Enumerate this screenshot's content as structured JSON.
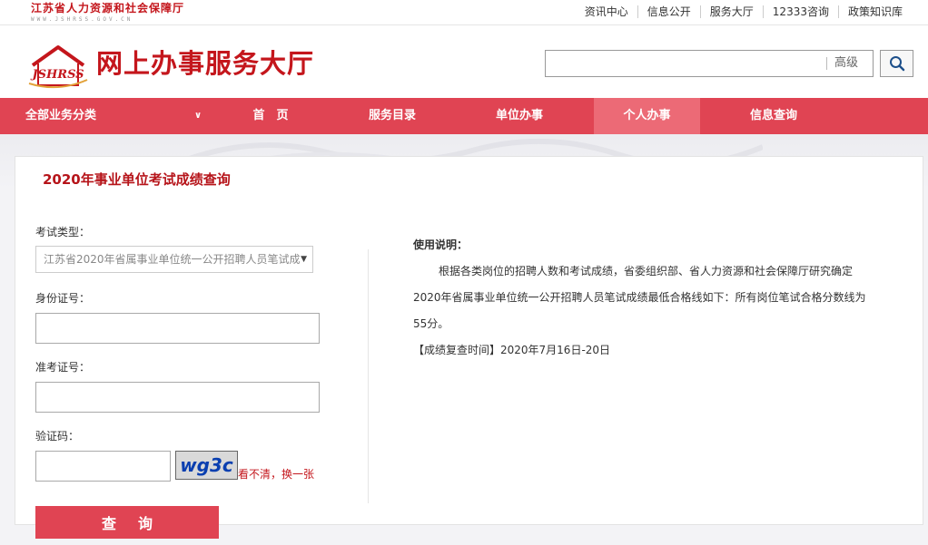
{
  "topbar": {
    "org_name": "江苏省人力资源和社会保障厅",
    "org_url": "WWW.JSHRSS.GOV.CN",
    "links": [
      "资讯中心",
      "信息公开",
      "服务大厅",
      "12333咨询",
      "政策知识库"
    ]
  },
  "header": {
    "logo_text": "JSHRSS",
    "title": "网上办事服务大厅",
    "search": {
      "value": "",
      "placeholder": "",
      "advanced_label": "高级"
    }
  },
  "nav": {
    "all_label": "全部业务分类",
    "items": [
      "首　页",
      "服务目录",
      "单位办事",
      "个人办事",
      "信息查询"
    ],
    "active": "个人办事"
  },
  "form": {
    "page_title": "2020年事业单位考试成绩查询",
    "exam_type_label": "考试类型：",
    "exam_type_selected": "江苏省2020年省属事业单位统一公开招聘人员笔试成",
    "id_label": "身份证号：",
    "id_value": "",
    "ticket_label": "准考证号：",
    "ticket_value": "",
    "captcha_label": "验证码：",
    "captcha_value": "",
    "captcha_image_text": "wg3c",
    "refresh_label": "看不清，换一张",
    "submit_label": "查询"
  },
  "instructions": {
    "heading": "使用说明：",
    "body": "根据各类岗位的招聘人数和考试成绩，省委组织部、省人力资源和社会保障厅研究确定2020年省属事业单位统一公开招聘人员笔试成绩最低合格线如下：所有岗位笔试合格分数线为55分。",
    "review_time": "【成绩复查时间】2020年7月16日-20日"
  },
  "colors": {
    "brand_red": "#c4161c",
    "nav_red": "#e04453",
    "nav_active": "#ec6a76",
    "captcha_text": "#0a3fb0"
  }
}
